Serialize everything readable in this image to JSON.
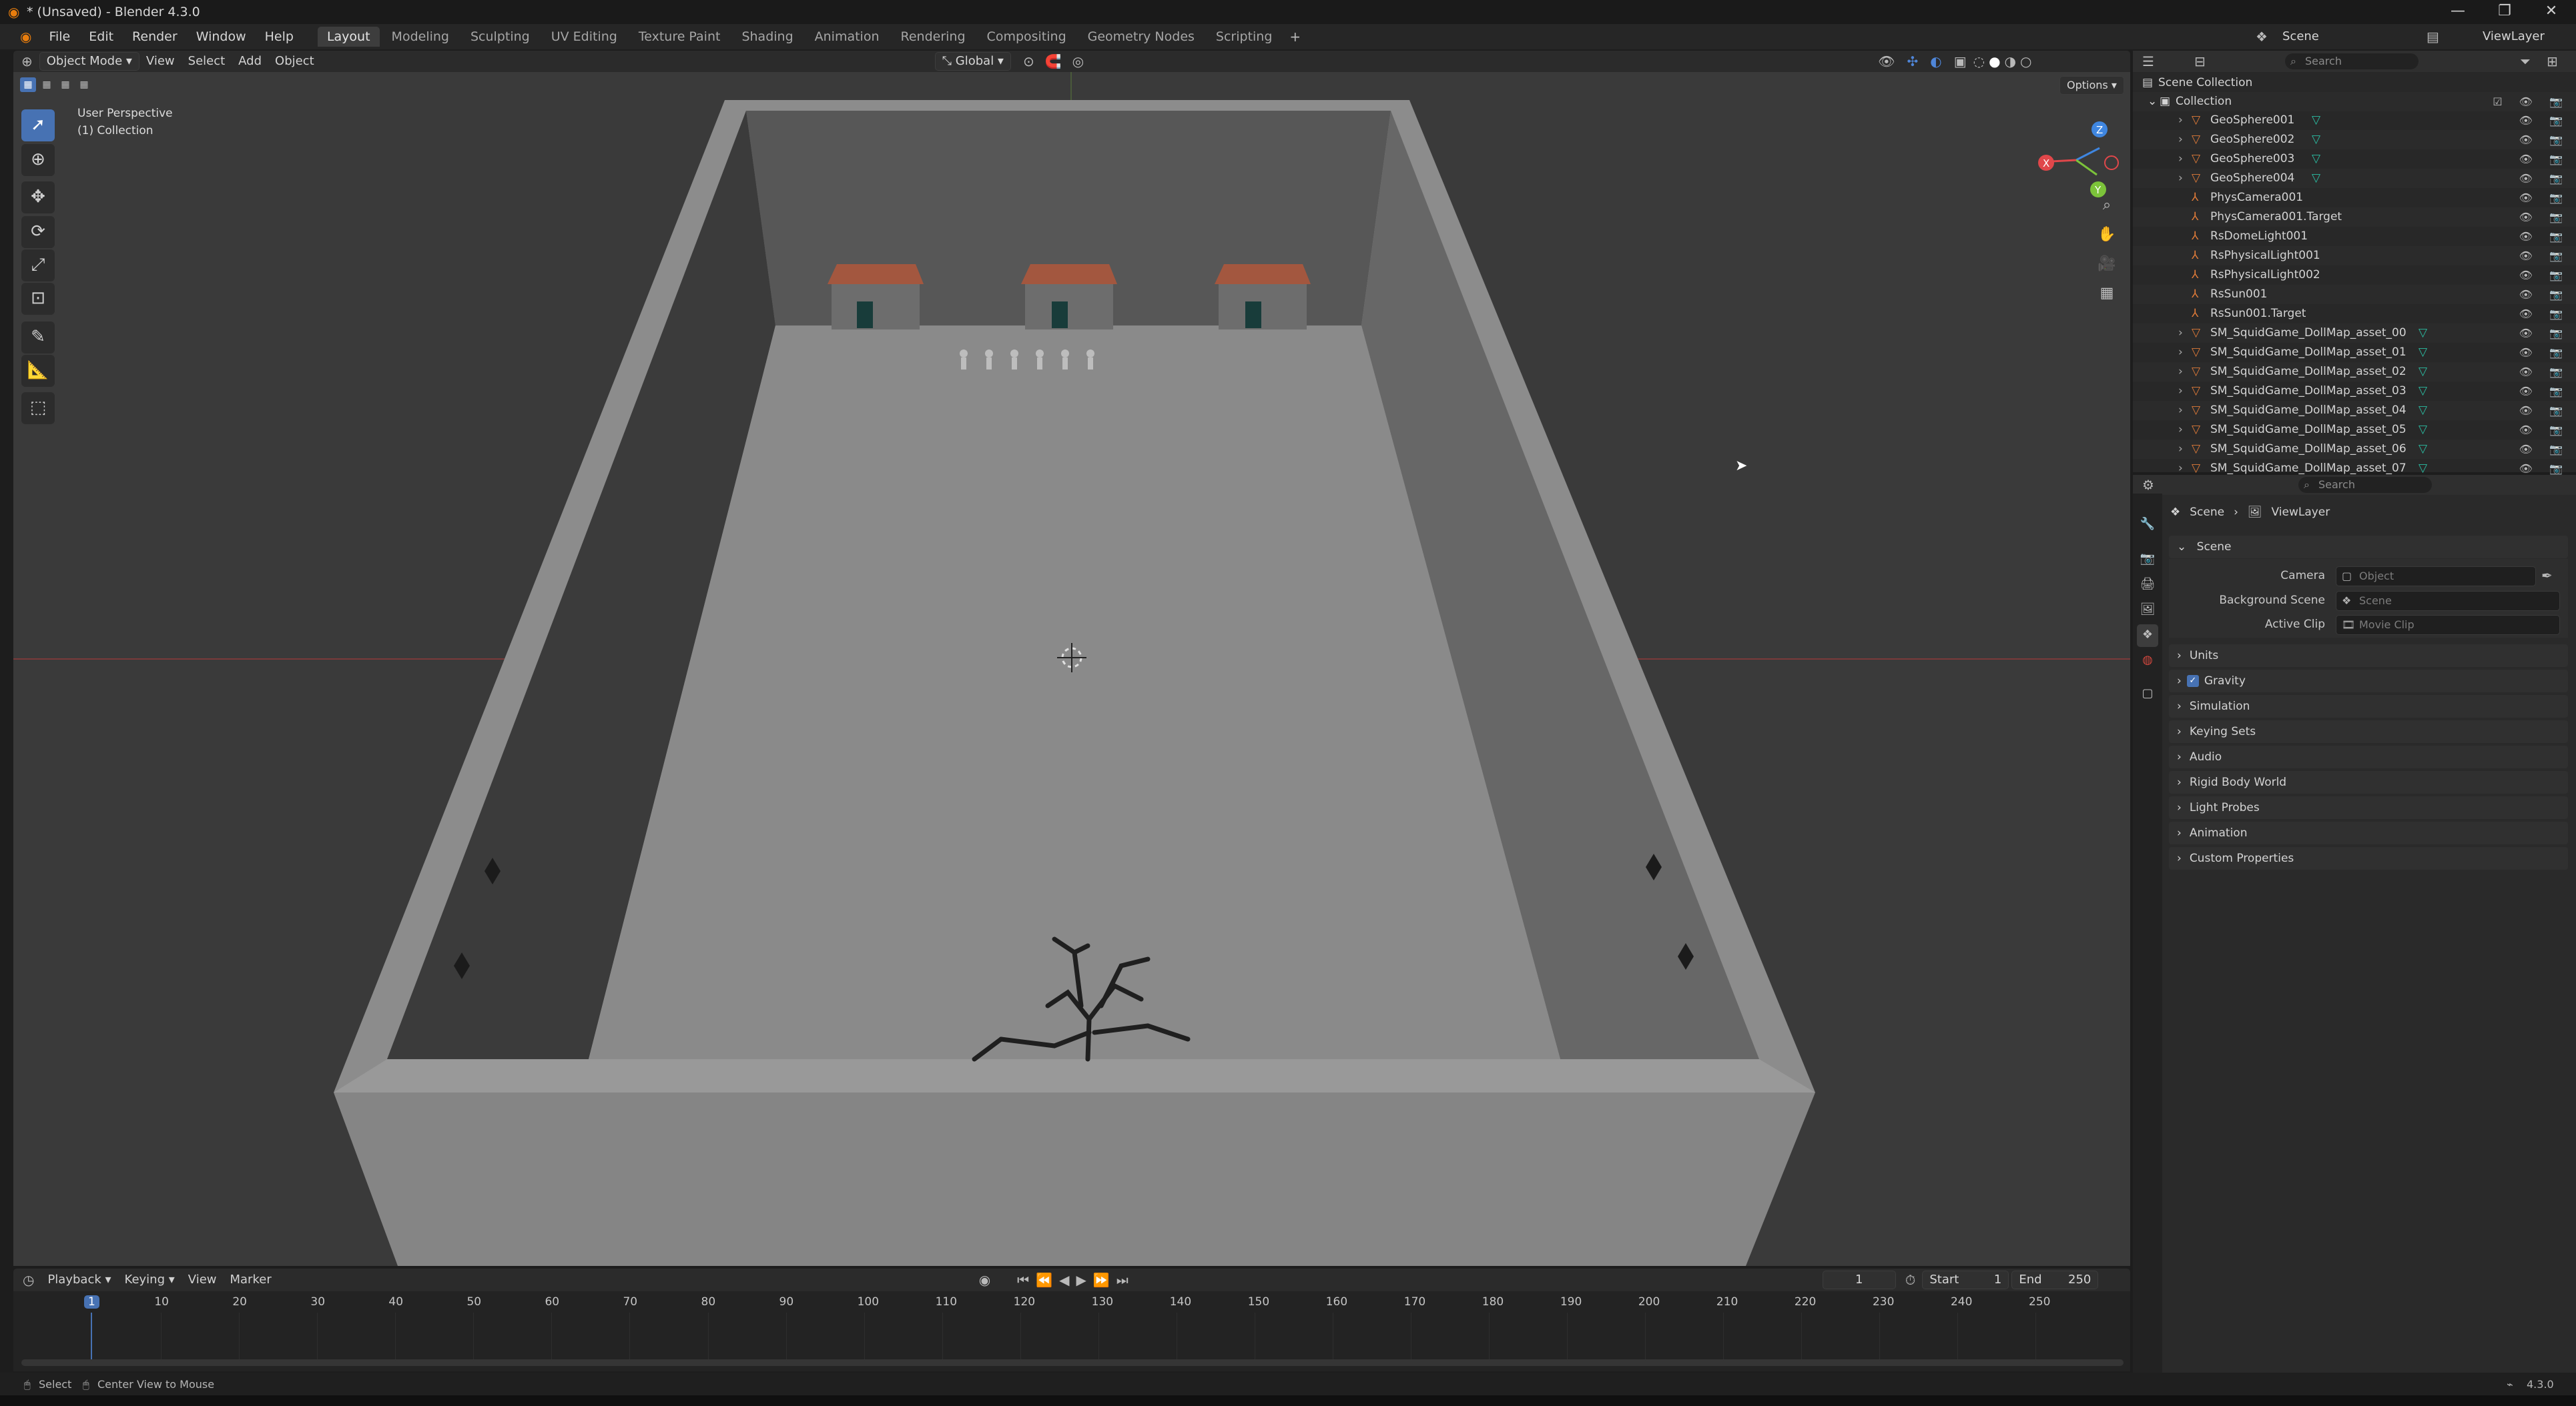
{
  "window": {
    "title": "* (Unsaved) - Blender 4.3.0",
    "controls": [
      "—",
      "❐",
      "✕"
    ]
  },
  "menubar": {
    "menus": [
      "File",
      "Edit",
      "Render",
      "Window",
      "Help"
    ],
    "workspaces": [
      "Layout",
      "Modeling",
      "Sculpting",
      "UV Editing",
      "Texture Paint",
      "Shading",
      "Animation",
      "Rendering",
      "Compositing",
      "Geometry Nodes",
      "Scripting"
    ],
    "active_workspace": "Layout",
    "scene_label": "Scene",
    "viewlayer_label": "ViewLayer"
  },
  "viewport_header": {
    "mode": "Object Mode",
    "menus": [
      "View",
      "Select",
      "Add",
      "Object"
    ],
    "transform_orientation": "Global",
    "options_label": "Options"
  },
  "viewport": {
    "perspective_label": "User Perspective",
    "collection_label": "(1) Collection",
    "gizmo_axes": [
      "X",
      "Y",
      "Z"
    ]
  },
  "outliner": {
    "search_placeholder": "Search",
    "root": "Scene Collection",
    "collection": "Collection",
    "items": [
      {
        "name": "GeoSphere001",
        "type": "mesh"
      },
      {
        "name": "GeoSphere002",
        "type": "mesh"
      },
      {
        "name": "GeoSphere003",
        "type": "mesh"
      },
      {
        "name": "GeoSphere004",
        "type": "mesh"
      },
      {
        "name": "PhysCamera001",
        "type": "empty"
      },
      {
        "name": "PhysCamera001.Target",
        "type": "empty"
      },
      {
        "name": "RsDomeLight001",
        "type": "empty"
      },
      {
        "name": "RsPhysicalLight001",
        "type": "empty"
      },
      {
        "name": "RsPhysicalLight002",
        "type": "empty"
      },
      {
        "name": "RsSun001",
        "type": "empty"
      },
      {
        "name": "RsSun001.Target",
        "type": "empty"
      },
      {
        "name": "SM_SquidGame_DollMap_asset_00",
        "type": "mesh"
      },
      {
        "name": "SM_SquidGame_DollMap_asset_01",
        "type": "mesh"
      },
      {
        "name": "SM_SquidGame_DollMap_asset_02",
        "type": "mesh"
      },
      {
        "name": "SM_SquidGame_DollMap_asset_03",
        "type": "mesh"
      },
      {
        "name": "SM_SquidGame_DollMap_asset_04",
        "type": "mesh"
      },
      {
        "name": "SM_SquidGame_DollMap_asset_05",
        "type": "mesh"
      },
      {
        "name": "SM_SquidGame_DollMap_asset_06",
        "type": "mesh"
      },
      {
        "name": "SM_SquidGame_DollMap_asset_07",
        "type": "mesh"
      }
    ]
  },
  "properties": {
    "search_placeholder": "Search",
    "breadcrumb": [
      "Scene",
      "ViewLayer"
    ],
    "scene_panel": "Scene",
    "fields": [
      {
        "label": "Camera",
        "placeholder": "Object"
      },
      {
        "label": "Background Scene",
        "placeholder": "Scene"
      },
      {
        "label": "Active Clip",
        "placeholder": "Movie Clip"
      }
    ],
    "panels": [
      "Units",
      "Gravity",
      "Simulation",
      "Keying Sets",
      "Audio",
      "Rigid Body World",
      "Light Probes",
      "Animation",
      "Custom Properties"
    ],
    "gravity_checked": true
  },
  "timeline": {
    "menus": [
      "Playback",
      "Keying",
      "View",
      "Marker"
    ],
    "current_frame": "1",
    "start_label": "Start",
    "start": "1",
    "end_label": "End",
    "end": "250",
    "ticks": [
      "1",
      "10",
      "20",
      "30",
      "40",
      "50",
      "60",
      "70",
      "80",
      "90",
      "100",
      "110",
      "120",
      "130",
      "140",
      "150",
      "160",
      "170",
      "180",
      "190",
      "200",
      "210",
      "220",
      "230",
      "240",
      "250"
    ]
  },
  "statusbar": {
    "left_hint_1": "Select",
    "left_hint_2": "Center View to Mouse",
    "version": "4.3.0"
  },
  "colors": {
    "accent": "#4772b3",
    "mesh_icon": "#e07b39",
    "vertex_icon": "#2bbfa4",
    "axis_x": "#e0474a",
    "axis_y": "#7cc33a",
    "axis_z": "#3f86e0"
  }
}
